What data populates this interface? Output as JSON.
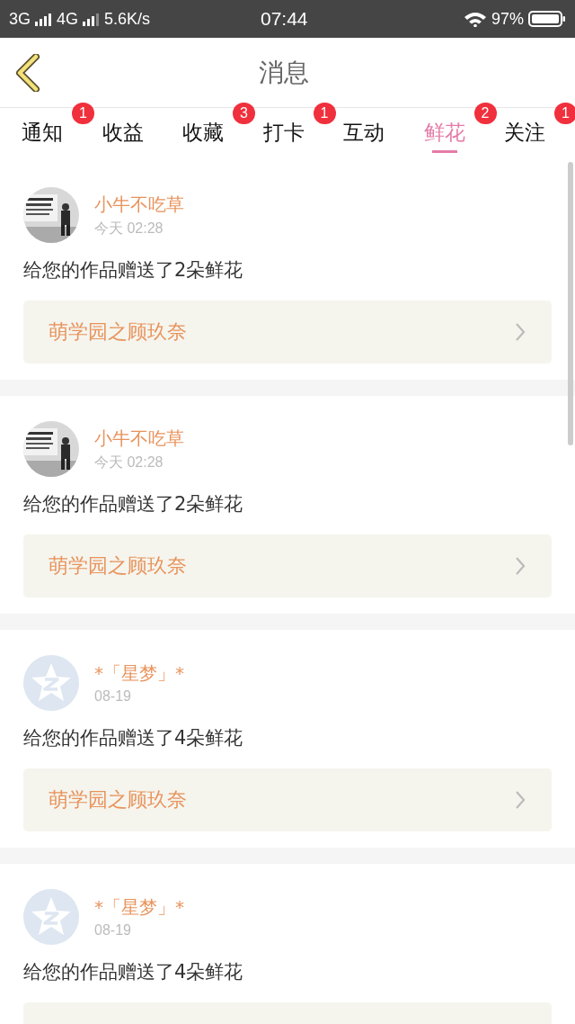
{
  "status_bar": {
    "network_1": "3G",
    "network_2": "4G",
    "speed": "5.6K/s",
    "time": "07:44",
    "battery": "97%"
  },
  "header": {
    "title": "消息"
  },
  "tabs": [
    {
      "label": "通知",
      "badge": "1",
      "selected": false
    },
    {
      "label": "收益",
      "selected": false
    },
    {
      "label": "收藏",
      "badge": "3",
      "selected": false
    },
    {
      "label": "打卡",
      "badge": "1",
      "selected": false
    },
    {
      "label": "互动",
      "selected": false
    },
    {
      "label": "鲜花",
      "badge": "2",
      "selected": true
    },
    {
      "label": "关注",
      "badge": "1",
      "selected": false
    }
  ],
  "messages": [
    {
      "kind": "picture",
      "name": "小牛不吃草",
      "time": "今天 02:28",
      "text": "给您的作品赠送了2朵鲜花",
      "link": "萌学园之顾玖奈"
    },
    {
      "kind": "picture",
      "name": "小牛不吃草",
      "time": "今天 02:28",
      "text": "给您的作品赠送了2朵鲜花",
      "link": "萌学园之顾玖奈"
    },
    {
      "kind": "default",
      "name": "*「星梦」*",
      "time": "08-19",
      "text": "给您的作品赠送了4朵鲜花",
      "link": "萌学园之顾玖奈"
    },
    {
      "kind": "default",
      "name": "*「星梦」*",
      "time": "08-19",
      "text": "给您的作品赠送了4朵鲜花"
    }
  ]
}
